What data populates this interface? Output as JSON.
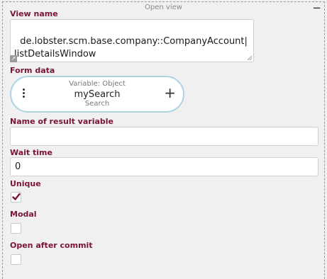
{
  "panel": {
    "title": "Open view"
  },
  "view_name": {
    "label": "View name",
    "value": "de.lobster.scm.base.company::CompanyAccount|\nlistDetailsWindow"
  },
  "form_data": {
    "label": "Form data",
    "variable_type": "Variable: Object",
    "variable_name": "mySearch",
    "variable_subtitle": "Search"
  },
  "result_variable": {
    "label": "Name of result variable",
    "value": ""
  },
  "wait_time": {
    "label": "Wait time",
    "value": "0"
  },
  "unique": {
    "label": "Unique",
    "checked": true
  },
  "modal": {
    "label": "Modal",
    "checked": false
  },
  "open_after_commit": {
    "label": "Open after commit",
    "checked": false
  },
  "colors": {
    "label": "#7a1436",
    "check": "#7a1436",
    "card_border": "#a9d4e2"
  }
}
